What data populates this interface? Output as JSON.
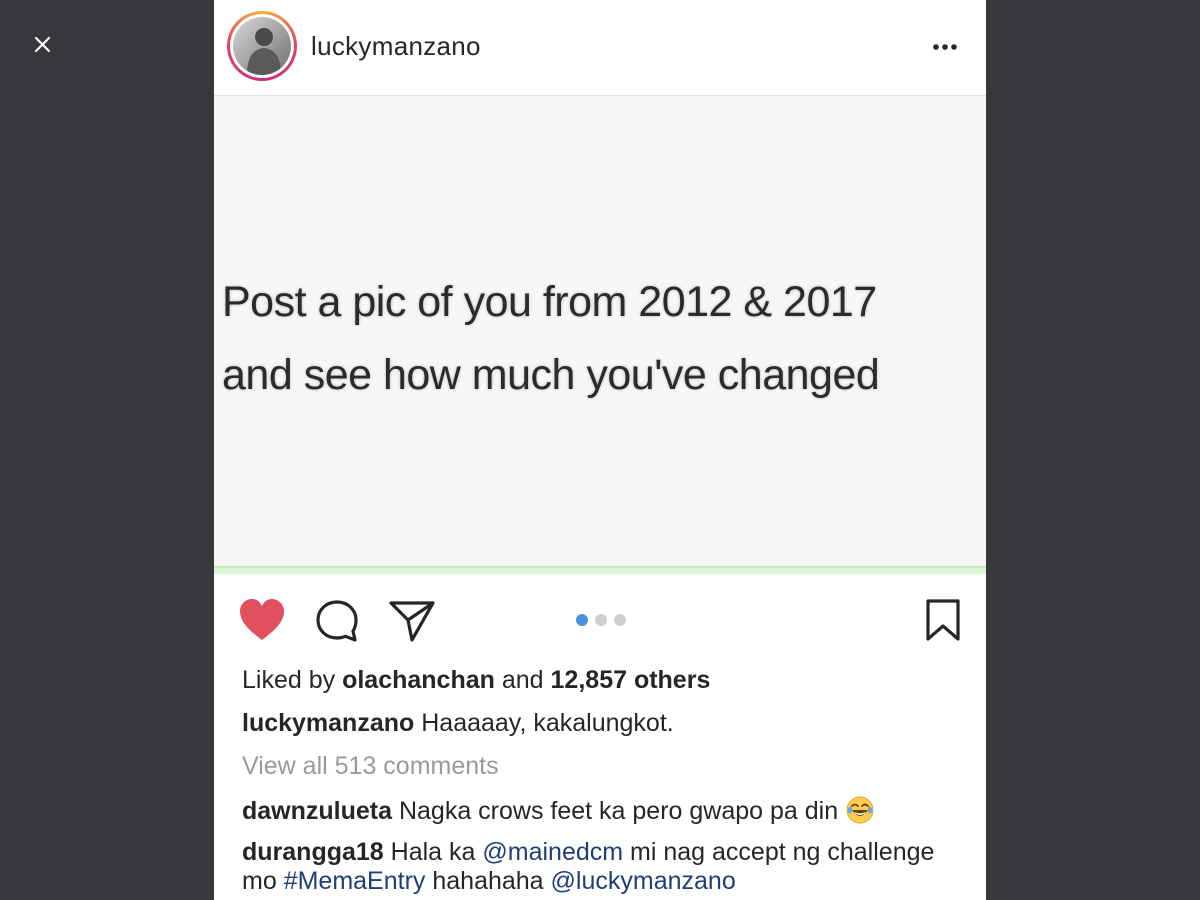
{
  "post": {
    "username": "luckymanzano",
    "image_text_line1": "Post a pic of you from 2012 & 2017",
    "image_text_line2": "and see how much you've changed",
    "carousel": {
      "count": 3,
      "active_index": 0
    },
    "likes": {
      "prefix": "Liked by",
      "user": "olachanchan",
      "middle": "and",
      "count_text": "12,857 others"
    },
    "caption": {
      "user": "luckymanzano",
      "text": "Haaaaay, kakalungkot."
    },
    "view_all_comments": "View all 513 comments",
    "comments": [
      {
        "user": "dawnzulueta",
        "text": "Nagka crows feet ka pero gwapo pa din"
      },
      {
        "user": "durangga18",
        "text_part1": "Hala ka",
        "mention1": "@mainedcm",
        "text_part2": "mi nag accept ng challenge mo",
        "hashtag": "#MemaEntry",
        "text_part3": "hahahaha",
        "mention2": "@luckymanzano"
      }
    ]
  },
  "colors": {
    "backdrop": "#36383c",
    "like_heart": "#e1505c",
    "carousel_active": "#4f8fe0",
    "mention": "#1e3e78"
  },
  "icons": [
    "close-icon",
    "more-options-icon",
    "heart-icon",
    "comment-icon",
    "share-icon",
    "bookmark-icon",
    "laughing-emoji-icon"
  ]
}
